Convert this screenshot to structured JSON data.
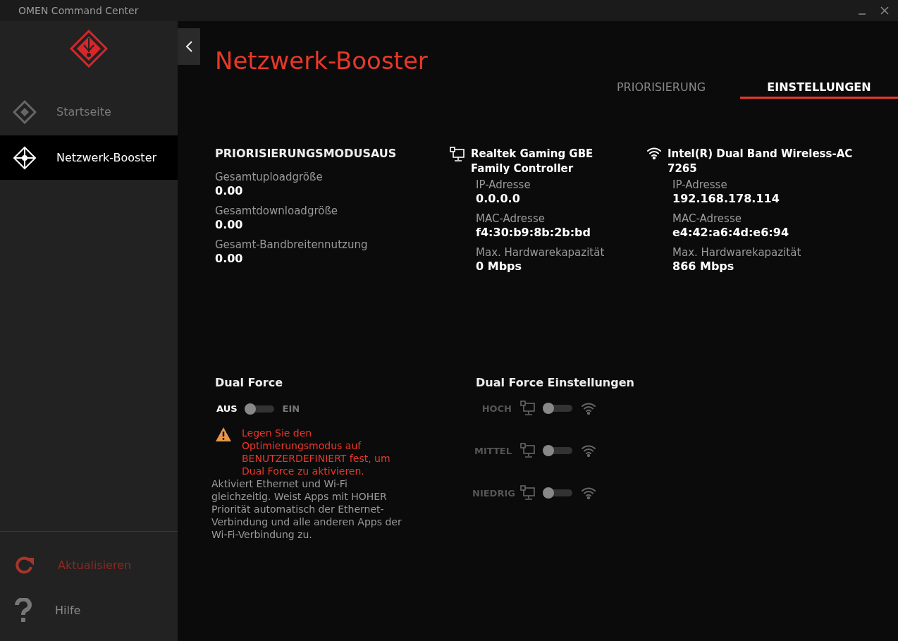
{
  "window": {
    "title": "OMEN Command Center"
  },
  "sidebar": {
    "items": [
      {
        "label": "Startseite",
        "kind": "home",
        "selected": false
      },
      {
        "label": "Netzwerk-Booster",
        "kind": "network",
        "selected": true
      }
    ],
    "footer_items": [
      {
        "label": "Aktualisieren",
        "kind": "update"
      },
      {
        "label": "Hilfe",
        "kind": "help"
      }
    ]
  },
  "page": {
    "title": "Netzwerk-Booster",
    "tabs": [
      {
        "label": "PRIORISIERUNG",
        "selected": false
      },
      {
        "label": "EINSTELLUNGEN",
        "selected": true
      }
    ],
    "summary": {
      "heading": "PRIORISIERUNGSMODUSAUS",
      "stats": [
        {
          "label": "Gesamtuploadgröße",
          "value": "0.00"
        },
        {
          "label": "Gesamtdownloadgröße",
          "value": "0.00"
        },
        {
          "label": "Gesamt-Bandbreitennutzung",
          "value": "0.00"
        }
      ]
    },
    "adapters": [
      {
        "kind": "ethernet",
        "name": "Realtek Gaming GBE Family Controller",
        "fields": [
          {
            "label": "IP-Adresse",
            "value": "0.0.0.0"
          },
          {
            "label": "MAC-Adresse",
            "value": "f4:30:b9:8b:2b:bd"
          },
          {
            "label": "Max. Hardwarekapazität",
            "value": "0 Mbps"
          }
        ]
      },
      {
        "kind": "wifi",
        "name": "Intel(R) Dual Band Wireless-AC 7265",
        "fields": [
          {
            "label": "IP-Adresse",
            "value": "192.168.178.114"
          },
          {
            "label": "MAC-Adresse",
            "value": "e4:42:a6:4d:e6:94"
          },
          {
            "label": "Max. Hardwarekapazität",
            "value": "866 Mbps"
          }
        ]
      }
    ],
    "dual_force": {
      "title": "Dual Force",
      "off_label": "AUS",
      "on_label": "EIN",
      "on": false,
      "warning": "Legen Sie den Optimierungsmodus auf BENUTZERDEFINIERT fest, um Dual Force zu aktivieren.",
      "description": "Aktiviert Ethernet und Wi-Fi gleichzeitig. Weist Apps mit HOHER Priorität automatisch der Ethernet-Verbindung und alle anderen Apps der Wi-Fi-Verbindung zu."
    },
    "dual_force_settings": {
      "title": "Dual Force Einstellungen",
      "rows": [
        {
          "label": "HOCH",
          "on": false
        },
        {
          "label": "MITTEL",
          "on": false
        },
        {
          "label": "NIEDRIG",
          "on": false
        }
      ]
    }
  }
}
